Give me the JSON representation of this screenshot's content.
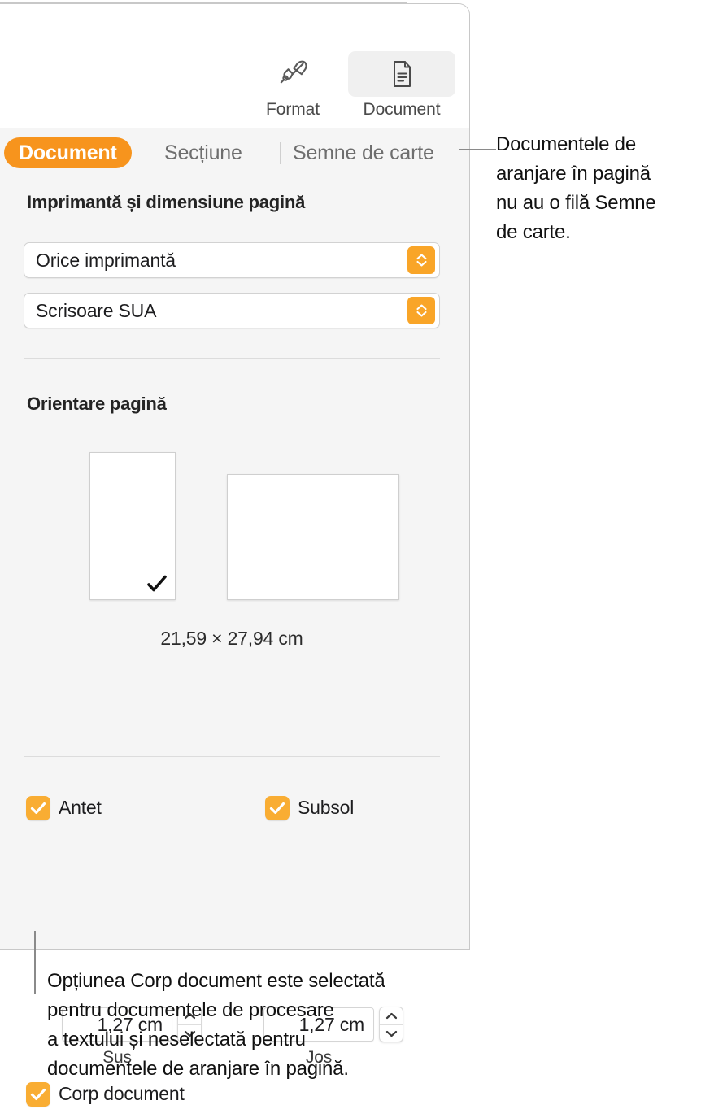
{
  "toolbar": {
    "items": [
      {
        "icon": "paintbrush-icon",
        "label": "Format",
        "selected": false
      },
      {
        "icon": "document-icon",
        "label": "Document",
        "selected": true
      }
    ]
  },
  "tabs": [
    {
      "label": "Document",
      "active": true
    },
    {
      "label": "Secțiune",
      "active": false
    },
    {
      "label": "Semne de carte",
      "active": false
    }
  ],
  "sections": {
    "printer": {
      "title": "Imprimantă și dimensiune pagină",
      "printer_popup": {
        "value": "Orice imprimantă"
      },
      "size_popup": {
        "value": "Scrisoare SUA"
      }
    },
    "orientation": {
      "title": "Orientare pagină",
      "portrait": {
        "name": "portrait",
        "selected": true
      },
      "landscape": {
        "name": "landscape",
        "selected": false
      },
      "dimensions": "21,59 × 27,94 cm"
    },
    "header_footer": {
      "header": {
        "label": "Antet",
        "checked": true,
        "value": "1,27 cm",
        "sub_label": "Sus"
      },
      "footer": {
        "label": "Subsol",
        "checked": true,
        "value": "1,27 cm",
        "sub_label": "Jos"
      },
      "body": {
        "label": "Corp document",
        "checked": true
      }
    }
  },
  "callouts": {
    "top": {
      "lines": [
        "Documentele de",
        "aranjare în pagină",
        "nu au o filă Semne",
        "de carte."
      ]
    },
    "bottom": {
      "lines": [
        "Opțiunea Corp document este selectată",
        "pentru documentele de procesare",
        "a textului și neselectată pentru",
        "documentele de aranjare în pagină."
      ]
    }
  },
  "colors": {
    "accent_orange": "#F7941D",
    "control_orange": "#F9A528",
    "checkbox_orange": "#F9AD33",
    "panel_bg": "#F5F5F5",
    "toolbar_bg": "#FFFFFF"
  }
}
